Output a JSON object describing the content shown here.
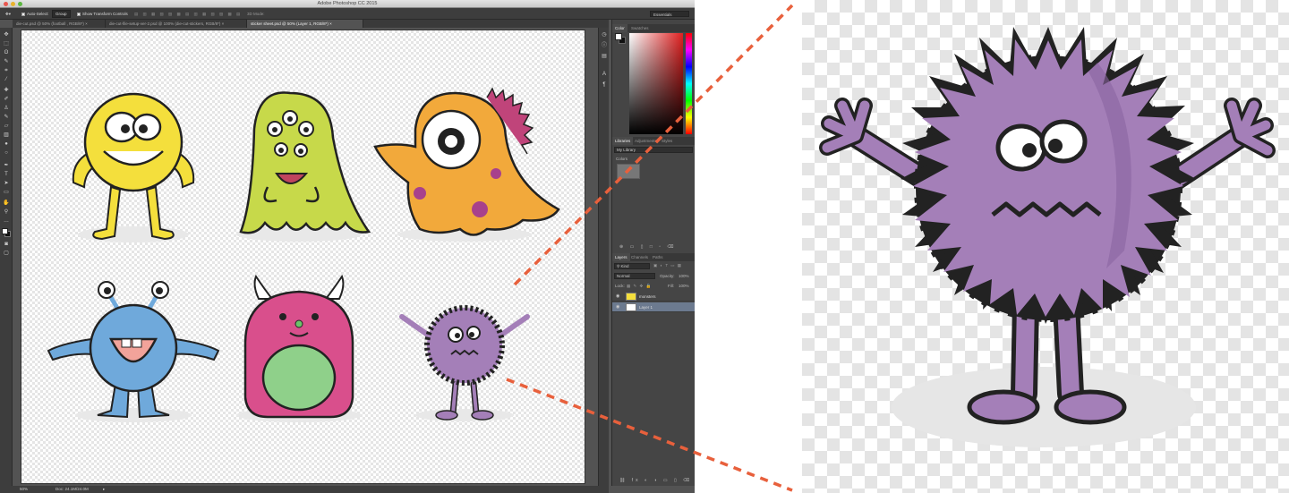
{
  "window": {
    "title": "Adobe Photoshop CC 2015"
  },
  "options_bar": {
    "auto_select_label": "Auto-Select:",
    "auto_select_value": "Group",
    "show_transform_label": "Show Transform Controls",
    "mode_3d_label": "3D Mode:",
    "workspace": "Essentials"
  },
  "tabs": [
    {
      "label": "die-cut.psd @ 50% (football , RGB/8*)"
    },
    {
      "label": "die-cut-file-setup-ver-2.psd @ 100% (die-cut-stickers, RGB/8*)"
    },
    {
      "label": "sticker sheet.psd @ 50% (Layer 1, RGB/8*)"
    }
  ],
  "status_bar": {
    "zoom": "50%",
    "doc": "Doc: 24.1M/24.0M"
  },
  "color_panel": {
    "tabs": [
      "Color",
      "Swatches"
    ]
  },
  "libraries_panel": {
    "tabs": [
      "Libraries",
      "Adjustments",
      "Styles"
    ],
    "library": "My Library",
    "section": "Colors"
  },
  "layers_panel": {
    "tabs": [
      "Layers",
      "Channels",
      "Paths"
    ],
    "filter": "Kind",
    "blend_mode": "Normal",
    "opacity_label": "Opacity:",
    "opacity": "100%",
    "lock_label": "Lock:",
    "fill_label": "Fill:",
    "fill": "100%",
    "layers": [
      {
        "name": "monsters",
        "selected": false
      },
      {
        "name": "Layer 1",
        "selected": true
      }
    ]
  },
  "colors": {
    "accent": "#e8603c",
    "panel_bg": "#454545",
    "canvas_bg": "#535353",
    "selected_layer": "#6c7a8f"
  },
  "monsters": [
    {
      "name": "yellow-monster",
      "color": "#f4df3c"
    },
    {
      "name": "green-monster",
      "color": "#c7d94a"
    },
    {
      "name": "orange-monster",
      "color": "#f2a93b"
    },
    {
      "name": "blue-monster",
      "color": "#6fa9db"
    },
    {
      "name": "pink-monster",
      "color": "#d94f8c"
    },
    {
      "name": "purple-monster",
      "color": "#a47fb8"
    }
  ]
}
